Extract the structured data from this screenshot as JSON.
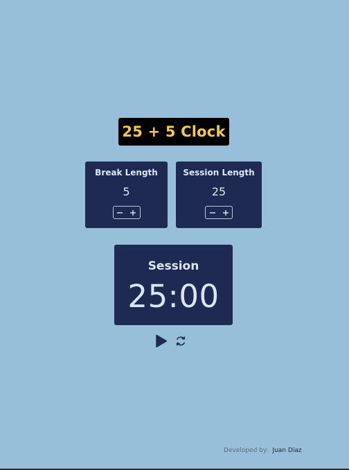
{
  "app": {
    "title": "25 + 5 Clock"
  },
  "break": {
    "label": "Break Length",
    "value": "5",
    "decrement_icon": "minus-icon",
    "increment_icon": "plus-icon"
  },
  "session": {
    "label": "Session Length",
    "value": "25",
    "decrement_icon": "minus-icon",
    "increment_icon": "plus-icon"
  },
  "timer": {
    "label": "Session",
    "display": "25:00"
  },
  "controls": {
    "play_icon": "play-icon",
    "reset_icon": "refresh-icon"
  },
  "footer": {
    "label": "Developed by:",
    "name": "Juan Diaz"
  },
  "colors": {
    "background": "#98bfd9",
    "panel": "#1e2a52",
    "panel_text": "#dbe6f5",
    "title_background": "#000000",
    "title_text": "#f7c948"
  }
}
